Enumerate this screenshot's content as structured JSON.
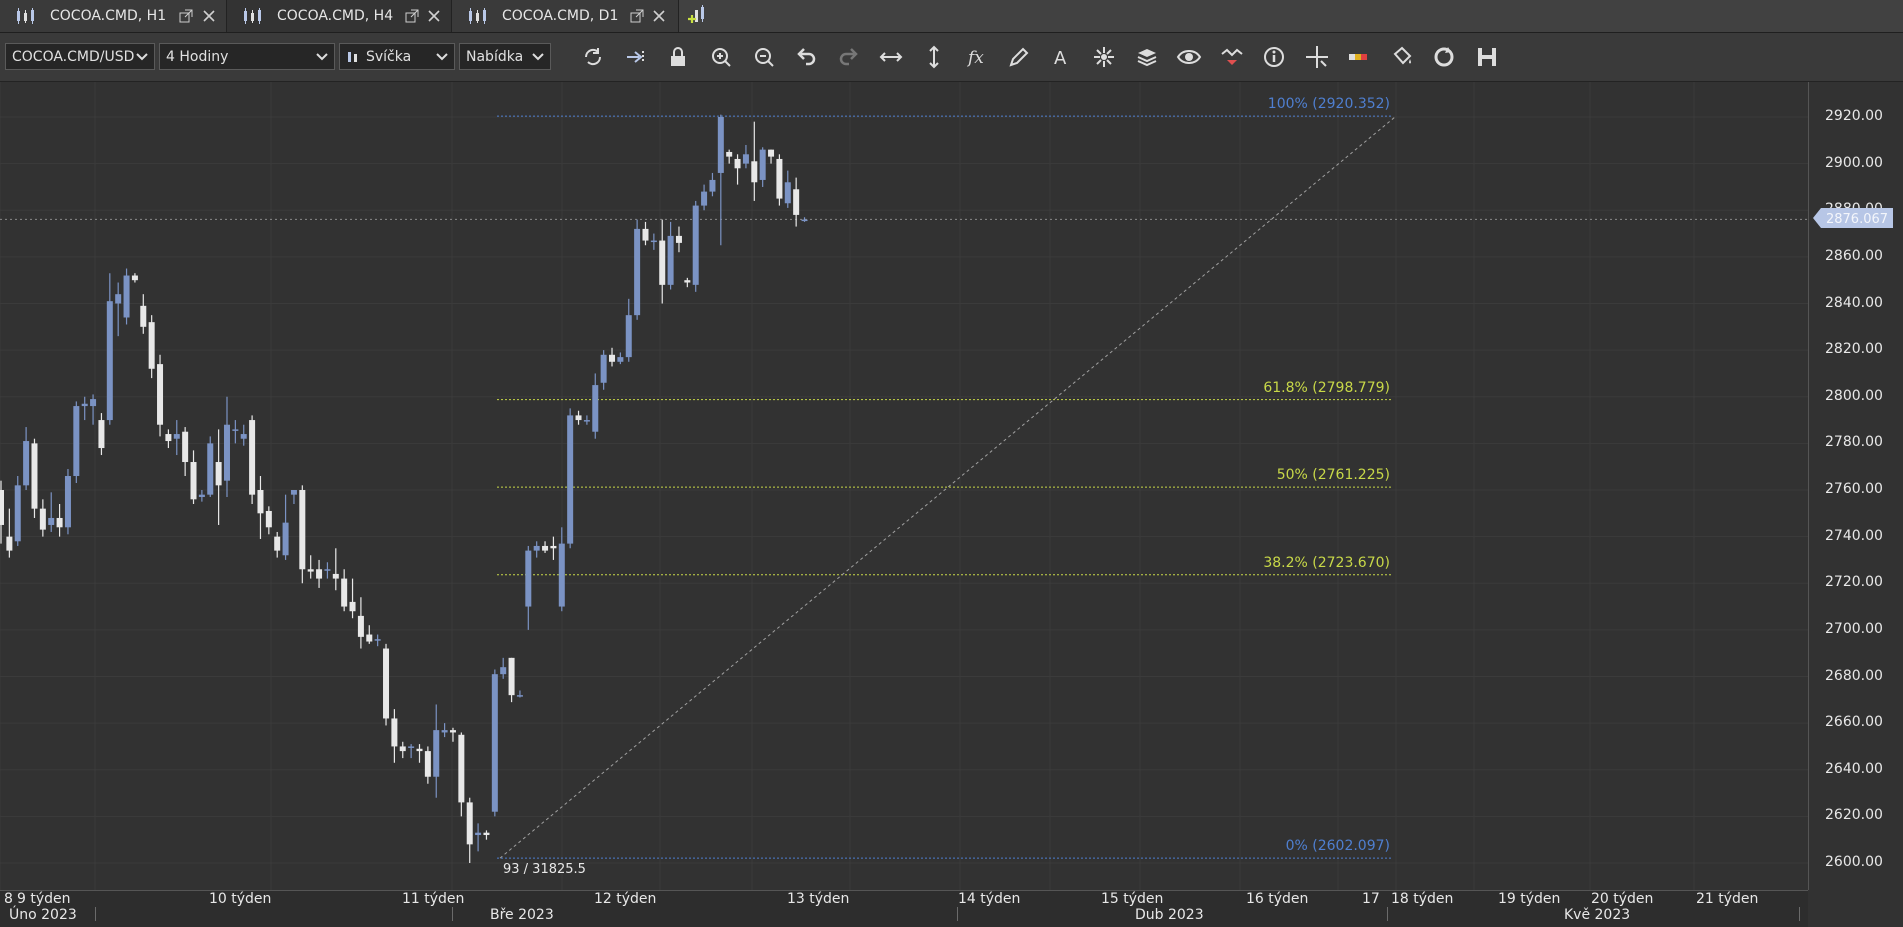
{
  "tabs": [
    {
      "label": "COCOA.CMD, H1",
      "active": false
    },
    {
      "label": "COCOA.CMD, H4",
      "active": true
    },
    {
      "label": "COCOA.CMD, D1",
      "active": false
    }
  ],
  "toolbar": {
    "instrument": "COCOA.CMD/USD",
    "period": "4 Hodiny",
    "chart_type": "Svíčka",
    "side": "Nabídka",
    "tools": [
      "refresh-icon",
      "auto-scroll-icon",
      "lock-icon",
      "zoom-in-icon",
      "zoom-out-icon",
      "undo-icon",
      "redo-icon",
      "horizontal-resize-icon",
      "vertical-resize-icon",
      "indicators-fx-icon",
      "pencil-icon",
      "text-tool-icon",
      "pattern-icon",
      "layers-icon",
      "eye-icon",
      "trade-arrows-icon",
      "info-icon",
      "crosshair-icon",
      "theme-colors-icon",
      "paint-bucket-icon",
      "sync-icon",
      "save-icon"
    ]
  },
  "colors": {
    "background": "#323232",
    "bull_candle": "#7b93c4",
    "bear_candle": "#e8e8e8",
    "fib_primary": "#4f7fd0",
    "fib_level": "#c8d848",
    "price_tag": "#b7c6e6"
  },
  "yaxis": {
    "labels": [
      "2920.00",
      "2900.00",
      "2880.00",
      "2860.00",
      "2840.00",
      "2820.00",
      "2800.00",
      "2780.00",
      "2760.00",
      "2740.00",
      "2720.00",
      "2700.00",
      "2680.00",
      "2660.00",
      "2640.00",
      "2620.00",
      "2600.00"
    ],
    "current_price": "2876.067"
  },
  "xaxis": {
    "weeks": [
      "8",
      "9 týden",
      "10 týden",
      "11 týden",
      "12 týden",
      "13 týden",
      "14 týden",
      "15 týden",
      "16 týden",
      "17",
      "18 týden",
      "19 týden",
      "20 týden",
      "21 týden"
    ],
    "months": [
      "Úno 2023",
      "Bře 2023",
      "Dub 2023",
      "Kvě 2023"
    ]
  },
  "fibonacci": [
    {
      "label": "100% (2920.352)",
      "price": 2920.352,
      "kind": "primary"
    },
    {
      "label": "61.8% (2798.779)",
      "price": 2798.779,
      "kind": "level"
    },
    {
      "label": "50% (2761.225)",
      "price": 2761.225,
      "kind": "level"
    },
    {
      "label": "38.2% (2723.670)",
      "price": 2723.67,
      "kind": "level"
    },
    {
      "label": "0% (2602.097)",
      "price": 2602.097,
      "kind": "primary"
    }
  ],
  "cursor_info": "93 / 31825.5",
  "chart_data": {
    "type": "candlestick",
    "symbol": "COCOA.CMD/USD",
    "timeframe": "4 Hodiny",
    "ylim": [
      2592,
      2928
    ],
    "candles": [
      [
        2760,
        2745,
        2764,
        2737
      ],
      [
        2740,
        2734,
        2752,
        2731
      ],
      [
        2738,
        2762,
        2766,
        2736
      ],
      [
        2762,
        2781,
        2787,
        2760
      ],
      [
        2780,
        2752,
        2782,
        2748
      ],
      [
        2752,
        2743,
        2756,
        2740
      ],
      [
        2745,
        2748,
        2759,
        2742
      ],
      [
        2748,
        2744,
        2754,
        2740
      ],
      [
        2744,
        2766,
        2769,
        2741
      ],
      [
        2766,
        2796,
        2798,
        2763
      ],
      [
        2796,
        2797,
        2800,
        2790
      ],
      [
        2796,
        2799,
        2801,
        2788
      ],
      [
        2790,
        2778,
        2793,
        2775
      ],
      [
        2790,
        2841,
        2853,
        2788
      ],
      [
        2840,
        2844,
        2849,
        2826
      ],
      [
        2834,
        2852,
        2855,
        2831
      ],
      [
        2852,
        2850,
        2853,
        2849
      ],
      [
        2839,
        2830,
        2844,
        2827
      ],
      [
        2832,
        2812,
        2835,
        2808
      ],
      [
        2814,
        2788,
        2818,
        2783
      ],
      [
        2784,
        2781,
        2786,
        2778
      ],
      [
        2782,
        2784,
        2790,
        2775
      ],
      [
        2785,
        2772,
        2787,
        2766
      ],
      [
        2772,
        2756,
        2777,
        2754
      ],
      [
        2757,
        2758,
        2760,
        2755
      ],
      [
        2758,
        2780,
        2783,
        2757
      ],
      [
        2772,
        2762,
        2786,
        2745
      ],
      [
        2764,
        2788,
        2800,
        2757
      ],
      [
        2786,
        2786,
        2790,
        2780
      ],
      [
        2782,
        2784,
        2788,
        2779
      ],
      [
        2790,
        2758,
        2792,
        2754
      ],
      [
        2760,
        2750,
        2766,
        2739
      ],
      [
        2751,
        2744,
        2753,
        2741
      ],
      [
        2740,
        2734,
        2742,
        2731
      ],
      [
        2732,
        2746,
        2758,
        2730
      ],
      [
        2758,
        2760,
        2760,
        2754
      ],
      [
        2760,
        2726,
        2762,
        2720
      ],
      [
        2726,
        2725,
        2732,
        2722
      ],
      [
        2726,
        2722,
        2730,
        2718
      ],
      [
        2726,
        2726,
        2729,
        2722
      ],
      [
        2724,
        2722,
        2735,
        2717
      ],
      [
        2722,
        2710,
        2726,
        2708
      ],
      [
        2712,
        2708,
        2722,
        2705
      ],
      [
        2706,
        2697,
        2714,
        2692
      ],
      [
        2698,
        2695,
        2702,
        2694
      ],
      [
        2696,
        2696,
        2698,
        2693
      ],
      [
        2692,
        2662,
        2694,
        2659
      ],
      [
        2662,
        2650,
        2666,
        2643
      ],
      [
        2650,
        2648,
        2652,
        2645
      ],
      [
        2650,
        2650,
        2651,
        2645
      ],
      [
        2649,
        2648,
        2651,
        2643
      ],
      [
        2648,
        2637,
        2650,
        2634
      ],
      [
        2637,
        2657,
        2668,
        2628
      ],
      [
        2656,
        2657,
        2660,
        2654
      ],
      [
        2657,
        2656,
        2658,
        2652
      ],
      [
        2655,
        2626,
        2656,
        2620
      ],
      [
        2626,
        2608,
        2628,
        2600
      ],
      [
        2612,
        2613,
        2617,
        2605
      ],
      [
        2613,
        2612,
        2614,
        2610
      ],
      [
        2622,
        2681,
        2683,
        2620
      ],
      [
        2681,
        2684,
        2688,
        2679
      ],
      [
        2688,
        2672,
        2688,
        2669
      ],
      [
        2672,
        2672,
        2674,
        2671
      ],
      [
        2710,
        2734,
        2736,
        2700
      ],
      [
        2734,
        2736,
        2738,
        2731
      ],
      [
        2736,
        2734,
        2738,
        2733
      ],
      [
        2736,
        2735,
        2740,
        2730
      ],
      [
        2710,
        2737,
        2744,
        2708
      ],
      [
        2737,
        2792,
        2795,
        2735
      ],
      [
        2792,
        2790,
        2794,
        2788
      ],
      [
        2790,
        2790,
        2792,
        2788
      ],
      [
        2785,
        2805,
        2810,
        2782
      ],
      [
        2806,
        2818,
        2820,
        2803
      ],
      [
        2818,
        2815,
        2821,
        2813
      ],
      [
        2815,
        2817,
        2819,
        2814
      ],
      [
        2817,
        2835,
        2842,
        2815
      ],
      [
        2835,
        2872,
        2876,
        2833
      ],
      [
        2872,
        2867,
        2875,
        2865
      ],
      [
        2867,
        2867,
        2870,
        2863
      ],
      [
        2867,
        2848,
        2876,
        2840
      ],
      [
        2848,
        2869,
        2875,
        2846
      ],
      [
        2869,
        2866,
        2873,
        2862
      ],
      [
        2850,
        2849,
        2851,
        2847
      ],
      [
        2848,
        2882,
        2884,
        2845
      ],
      [
        2882,
        2888,
        2891,
        2880
      ],
      [
        2888,
        2893,
        2896,
        2886
      ],
      [
        2896,
        2920,
        2921,
        2865
      ],
      [
        2905,
        2903,
        2906,
        2900
      ],
      [
        2902,
        2898,
        2904,
        2891
      ],
      [
        2900,
        2904,
        2908,
        2898
      ],
      [
        2901,
        2892,
        2918,
        2884
      ],
      [
        2893,
        2906,
        2907,
        2890
      ],
      [
        2906,
        2903,
        2906,
        2900
      ],
      [
        2902,
        2885,
        2904,
        2882
      ],
      [
        2883,
        2892,
        2897,
        2881
      ],
      [
        2889,
        2878,
        2894,
        2873
      ],
      [
        2876,
        2876,
        2877,
        2875
      ]
    ]
  }
}
